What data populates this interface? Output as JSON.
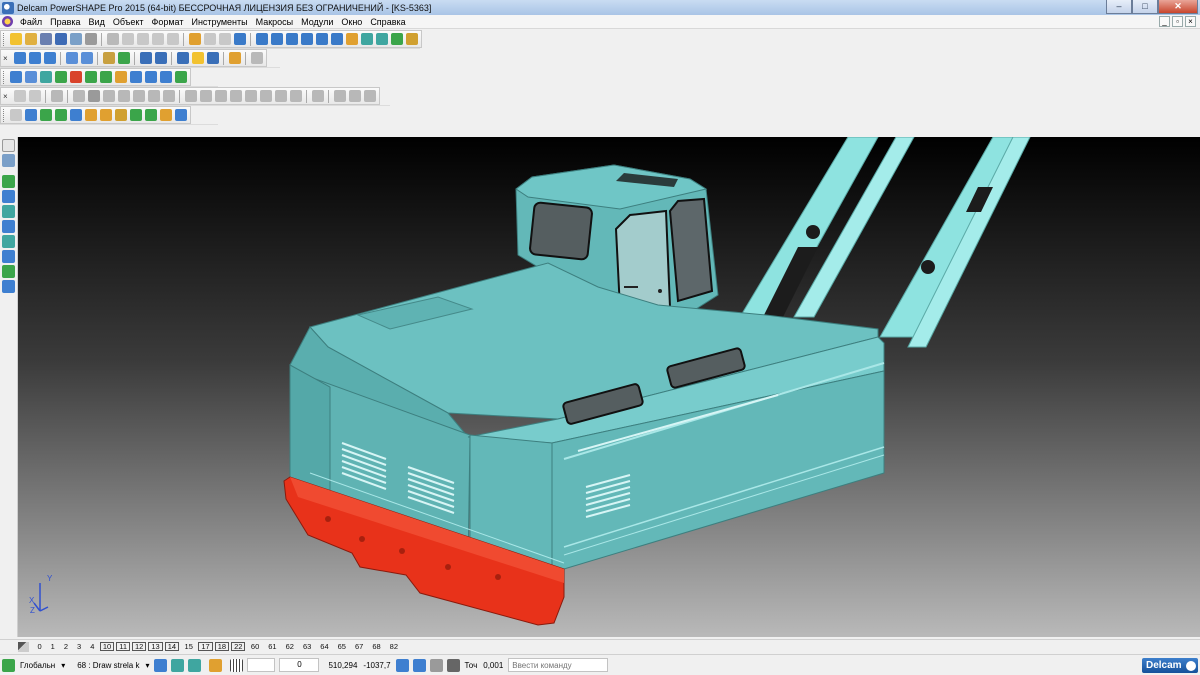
{
  "window": {
    "title": "Delcam PowerSHAPE Pro 2015 (64-bit) БЕССРОЧНАЯ ЛИЦЕНЗИЯ БЕЗ ОГРАНИЧЕНИЙ - [KS-5363]",
    "btn_min": "–",
    "btn_max": "□",
    "btn_close": "✕"
  },
  "menu": {
    "items": [
      "Файл",
      "Правка",
      "Вид",
      "Объект",
      "Формат",
      "Инструменты",
      "Макросы",
      "Модули",
      "Окно",
      "Справка"
    ],
    "mdi_min": "_",
    "mdi_restore": "▫",
    "mdi_close": "×"
  },
  "toolbars": {
    "close_glyph": "×",
    "colors": {
      "blue": "#3e7fd0",
      "yellow": "#f2c230",
      "green": "#3ba54a",
      "red": "#d9432b",
      "teal": "#3fa6a0",
      "grey": "#9a9a9a"
    }
  },
  "viewport": {
    "background_top": "#000000",
    "background_bottom": "#b9b9b9",
    "body_color": "#5fb3b3",
    "cab_color": "#63b8b8",
    "boom_color": "#8ee3e0",
    "bumper_color": "#e8321a",
    "axis": {
      "y": "Y",
      "x": "X",
      "z": "Z"
    }
  },
  "levels": {
    "items": [
      "0",
      "1",
      "2",
      "3",
      "4",
      "10",
      "11",
      "12",
      "13",
      "14",
      "15",
      "17",
      "18",
      "22",
      "60",
      "61",
      "62",
      "63",
      "64",
      "65",
      "67",
      "68",
      "82"
    ],
    "boxed": [
      "10",
      "11",
      "12",
      "13",
      "14",
      "17",
      "18",
      "22"
    ]
  },
  "status": {
    "workplane": "Глобальн",
    "level_value": "68 : Draw strela k",
    "field_value": "0",
    "coord_x": "510,294",
    "coord_y": "-1037,7",
    "tolerance_label": "Точ",
    "tolerance_value": "0,001",
    "command_placeholder": "Ввести команду",
    "logo": "Delcam"
  }
}
